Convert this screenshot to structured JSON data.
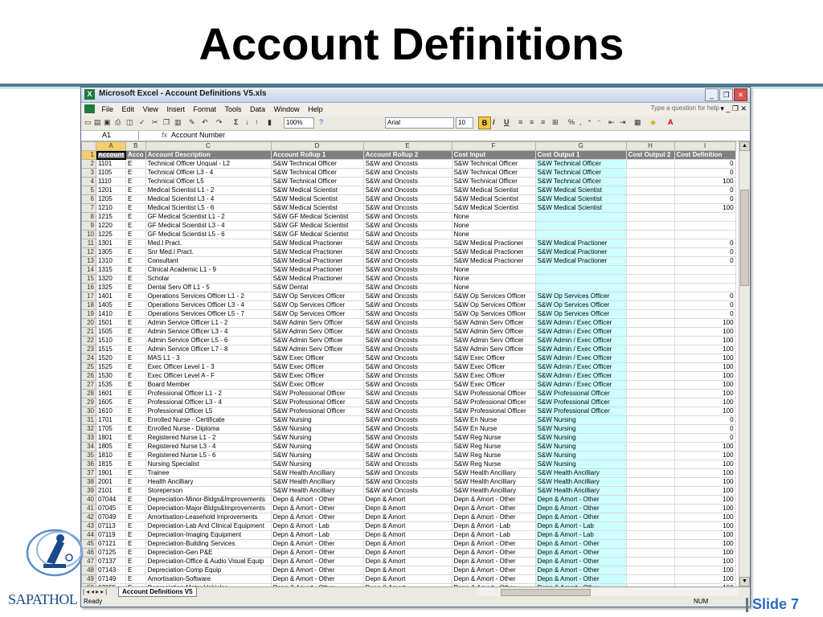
{
  "slide": {
    "title": "Account Definitions",
    "slide_number": "Slide 7",
    "logo_text": "SAPATHOL"
  },
  "window": {
    "title": "Microsoft Excel - Account Definitions V5.xls",
    "menus": [
      "File",
      "Edit",
      "View",
      "Insert",
      "Format",
      "Tools",
      "Data",
      "Window",
      "Help"
    ],
    "help_placeholder": "Type a question for help",
    "zoom": "100%",
    "font_name": "Arial",
    "font_size": "10",
    "name_box": "A1",
    "formula": "Account Number",
    "sheet_tab": "Account Definitions V5",
    "status": "Ready",
    "num_lock": "NUM"
  },
  "sheet": {
    "columns": [
      "A",
      "B",
      "C",
      "D",
      "E",
      "F",
      "G",
      "H",
      "I"
    ],
    "header_row": [
      "Account",
      "Acco",
      "Account Description",
      "Account Rollup 1",
      "Account Rollup 2",
      "Cost Input",
      "Cost Output 1",
      "Cost Output 2",
      "Cost Definition"
    ],
    "rows": [
      [
        "2",
        "1101",
        "E",
        "Technical Officer Unqual - L2",
        "S&W Technical Officer",
        "S&W and Oncosts",
        "S&W Technical Officer",
        "S&W Technical Officer",
        "",
        "0"
      ],
      [
        "3",
        "1105",
        "E",
        "Technical Officer L3 - 4",
        "S&W Technical Officer",
        "S&W and Oncosts",
        "S&W Technical Officer",
        "S&W Technical Officer",
        "",
        "0"
      ],
      [
        "4",
        "1110",
        "E",
        "Technical Officer L5",
        "S&W Technical Officer",
        "S&W and Oncosts",
        "S&W Technical Officer",
        "S&W Technical Officer",
        "",
        "100"
      ],
      [
        "5",
        "1201",
        "E",
        "Medical Scientist L1 - 2",
        "S&W Medical Scientist",
        "S&W and Oncosts",
        "S&W Medical Scientist",
        "S&W Medical Scientist",
        "",
        "0"
      ],
      [
        "6",
        "1205",
        "E",
        "Medical Scientist L3 - 4",
        "S&W Medical Scientist",
        "S&W and Oncosts",
        "S&W Medical Scientist",
        "S&W Medical Scientist",
        "",
        "0"
      ],
      [
        "7",
        "1210",
        "E",
        "Medical Scientist L5 - 6",
        "S&W Medical Scientist",
        "S&W and Oncosts",
        "S&W Medical Scientist",
        "S&W Medical Scientist",
        "",
        "100"
      ],
      [
        "8",
        "1215",
        "E",
        "GF Medical Scientist L1 - 2",
        "S&W GF Medical Scientist",
        "S&W and Oncosts",
        "None",
        "",
        "",
        ""
      ],
      [
        "9",
        "1220",
        "E",
        "GF Medical Scientist L3 - 4",
        "S&W GF Medical Scientist",
        "S&W and Oncosts",
        "None",
        "",
        "",
        ""
      ],
      [
        "10",
        "1225",
        "E",
        "GF Medical Scientist L5 - 6",
        "S&W GF Medical Scientist",
        "S&W and Oncosts",
        "None",
        "",
        "",
        ""
      ],
      [
        "11",
        "1301",
        "E",
        "Med.l Pract.",
        "S&W Medical Practioner",
        "S&W and Oncosts",
        "S&W Medical Practioner",
        "S&W Medical Practioner",
        "",
        "0"
      ],
      [
        "12",
        "1305",
        "E",
        "Snr Med.l Pract.",
        "S&W Medical Practioner",
        "S&W and Oncosts",
        "S&W Medical Practioner",
        "S&W Medical Practioner",
        "",
        "0"
      ],
      [
        "13",
        "1310",
        "E",
        "Consultant",
        "S&W Medical Practioner",
        "S&W and Oncosts",
        "S&W Medical Practioner",
        "S&W Medical Practioner",
        "",
        "0"
      ],
      [
        "14",
        "1315",
        "E",
        "Clinical Academic L1 - 9",
        "S&W Medical Practioner",
        "S&W and Oncosts",
        "None",
        "",
        "",
        ""
      ],
      [
        "15",
        "1320",
        "E",
        "Scholar",
        "S&W Medical Practioner",
        "S&W and Oncosts",
        "None",
        "",
        "",
        ""
      ],
      [
        "16",
        "1325",
        "E",
        "Dental Serv Off L1 - 5",
        "S&W Dental",
        "S&W and Oncosts",
        "None",
        "",
        "",
        ""
      ],
      [
        "17",
        "1401",
        "E",
        "Operations Services Officer L1 - 2",
        "S&W Op Services Officer",
        "S&W and Oncosts",
        "S&W Op Services Officer",
        "S&W Op Services Officer",
        "",
        "0"
      ],
      [
        "18",
        "1405",
        "E",
        "Operations Services Officer L3 - 4",
        "S&W Op Services Officer",
        "S&W and Oncosts",
        "S&W Op Services Officer",
        "S&W Op Services Officer",
        "",
        "0"
      ],
      [
        "19",
        "1410",
        "E",
        "Operations Services Officer L5 - 7",
        "S&W Op Services Officer",
        "S&W and Oncosts",
        "S&W Op Services Officer",
        "S&W Op Services Officer",
        "",
        "0"
      ],
      [
        "20",
        "1501",
        "E",
        "Admin Service Officer L1 - 2",
        "S&W Admin Serv Officer",
        "S&W and Oncosts",
        "S&W Admin Serv Officer",
        "S&W Admin / Exec Officer",
        "",
        "100"
      ],
      [
        "21",
        "1505",
        "E",
        "Admin Service Officer L3 - 4",
        "S&W Admin Serv Officer",
        "S&W and Oncosts",
        "S&W Admin Serv Officer",
        "S&W Admin / Exec Officer",
        "",
        "100"
      ],
      [
        "22",
        "1510",
        "E",
        "Admin Service Officer L5 - 6",
        "S&W Admin Serv Officer",
        "S&W and Oncosts",
        "S&W Admin Serv Officer",
        "S&W Admin / Exec Officer",
        "",
        "100"
      ],
      [
        "23",
        "1515",
        "E",
        "Admin Service Officer L7 - 8",
        "S&W Admin Serv Officer",
        "S&W and Oncosts",
        "S&W Admin Serv Officer",
        "S&W Admin / Exec Officer",
        "",
        "100"
      ],
      [
        "24",
        "1520",
        "E",
        "MAS L1 - 3",
        "S&W Exec Officer",
        "S&W and Oncosts",
        "S&W Exec Officer",
        "S&W Admin / Exec Officer",
        "",
        "100"
      ],
      [
        "25",
        "1525",
        "E",
        "Exec Officer Level 1 - 3",
        "S&W Exec Officer",
        "S&W and Oncosts",
        "S&W Exec Officer",
        "S&W Admin / Exec Officer",
        "",
        "100"
      ],
      [
        "26",
        "1530",
        "E",
        "Exec Officer Level A - F",
        "S&W Exec Officer",
        "S&W and Oncosts",
        "S&W Exec Officer",
        "S&W Admin / Exec Officer",
        "",
        "100"
      ],
      [
        "27",
        "1535",
        "E",
        "Board Member",
        "S&W Exec Officer",
        "S&W and Oncosts",
        "S&W Exec Officer",
        "S&W Admin / Exec Officer",
        "",
        "100"
      ],
      [
        "28",
        "1601",
        "E",
        "Professional Officer L1 - 2",
        "S&W Professional Officer",
        "S&W and Oncosts",
        "S&W Professional Officer",
        "S&W Professional Officer",
        "",
        "100"
      ],
      [
        "29",
        "1605",
        "E",
        "Professional Officer L3 - 4",
        "S&W Professional Officer",
        "S&W and Oncosts",
        "S&W Professional Officer",
        "S&W Professional Officer",
        "",
        "100"
      ],
      [
        "30",
        "1610",
        "E",
        "Professional Officer L5",
        "S&W Professional Officer",
        "S&W and Oncosts",
        "S&W Professional Officer",
        "S&W Professional Officer",
        "",
        "100"
      ],
      [
        "31",
        "1701",
        "E",
        "Enrolled Nurse - Certificate",
        "S&W Nursing",
        "S&W and Oncosts",
        "S&W En Nurse",
        "S&W Nursing",
        "",
        "0"
      ],
      [
        "32",
        "1705",
        "E",
        "Enrolled Nurse - Diploma",
        "S&W Nursing",
        "S&W and Oncosts",
        "S&W En Nurse",
        "S&W Nursing",
        "",
        "0"
      ],
      [
        "33",
        "1801",
        "E",
        "Registered Nurse L1 - 2",
        "S&W Nursing",
        "S&W and Oncosts",
        "S&W Reg Nurse",
        "S&W Nursing",
        "",
        "0"
      ],
      [
        "34",
        "1805",
        "E",
        "Registered Nurse L3 - 4",
        "S&W Nursing",
        "S&W and Oncosts",
        "S&W Reg Nurse",
        "S&W Nursing",
        "",
        "100"
      ],
      [
        "35",
        "1810",
        "E",
        "Registered Nurse L5 - 6",
        "S&W Nursing",
        "S&W and Oncosts",
        "S&W Reg Nurse",
        "S&W Nursing",
        "",
        "100"
      ],
      [
        "36",
        "1815",
        "E",
        "Nursing Specialist",
        "S&W Nursing",
        "S&W and Oncosts",
        "S&W Reg Nurse",
        "S&W Nursing",
        "",
        "100"
      ],
      [
        "37",
        "1901",
        "E",
        "Trainee",
        "S&W Health Ancilliary",
        "S&W and Oncosts",
        "S&W Health Ancilliary",
        "S&W Health Ancilliary",
        "",
        "100"
      ],
      [
        "38",
        "2001",
        "E",
        "Health Ancilliary",
        "S&W Health Ancilliary",
        "S&W and Oncosts",
        "S&W Health Ancilliary",
        "S&W Health Ancilliary",
        "",
        "100"
      ],
      [
        "39",
        "2101",
        "E",
        "Storeperson",
        "S&W Health Ancilliary",
        "S&W and Oncosts",
        "S&W Health Ancilliary",
        "S&W Health Ancilliary",
        "",
        "100"
      ],
      [
        "40",
        "07044",
        "E",
        "Depreciation-Minor-Bldgs&Improvements",
        "Depn & Amort - Other",
        "Depn & Amort",
        "Depn & Amort - Other",
        "Depn & Amort - Other",
        "",
        "100"
      ],
      [
        "41",
        "07045",
        "E",
        "Depreciation-Major-Bldgs&Improvements",
        "Depn & Amort - Other",
        "Depn & Amort",
        "Depn & Amort - Other",
        "Depn & Amort - Other",
        "",
        "100"
      ],
      [
        "42",
        "07049",
        "E",
        "Amortisation-Leasehold Improvements",
        "Depn & Amort - Other",
        "Depn & Amort",
        "Depn & Amort - Other",
        "Depn & Amort - Other",
        "",
        "100"
      ],
      [
        "43",
        "07113",
        "E",
        "Depreciation-Lab And Clinical Equipment",
        "Depn & Amort - Lab",
        "Depn & Amort",
        "Depn & Amort - Lab",
        "Depn & Amort - Lab",
        "",
        "100"
      ],
      [
        "44",
        "07119",
        "E",
        "Depreciation-Imaging Equipment",
        "Depn & Amort - Lab",
        "Depn & Amort",
        "Depn & Amort - Lab",
        "Depn & Amort - Lab",
        "",
        "100"
      ],
      [
        "45",
        "07121",
        "E",
        "Depreciation-Building Services",
        "Depn & Amort - Other",
        "Depn & Amort",
        "Depn & Amort - Other",
        "Depn & Amort - Other",
        "",
        "100"
      ],
      [
        "46",
        "07125",
        "E",
        "Depreciation-Gen P&E",
        "Depn & Amort - Other",
        "Depn & Amort",
        "Depn & Amort - Other",
        "Depn & Amort - Other",
        "",
        "100"
      ],
      [
        "47",
        "07137",
        "E",
        "Depreciation-Office & Audio Visual Equip",
        "Depn & Amort - Other",
        "Depn & Amort",
        "Depn & Amort - Other",
        "Depn & Amort - Other",
        "",
        "100"
      ],
      [
        "48",
        "07143",
        "E",
        "Depreciation-Comp Equip",
        "Depn & Amort - Other",
        "Depn & Amort",
        "Depn & Amort - Other",
        "Depn & Amort - Other",
        "",
        "100"
      ],
      [
        "49",
        "07149",
        "E",
        "Amortisation-Software",
        "Depn & Amort - Other",
        "Depn & Amort",
        "Depn & Amort - Other",
        "Depn & Amort - Other",
        "",
        "100"
      ],
      [
        "50",
        "07155",
        "E",
        "Depreciation-Motor Vehicles",
        "Depn & Amort - Other",
        "Depn & Amort",
        "Depn & Amort - Other",
        "Depn & Amort - Other",
        "",
        "100"
      ]
    ]
  },
  "colors": {
    "header_fill": "#808080",
    "cost_output_fill": "#ccffff",
    "title_rule": "#4a7f8c",
    "slide_number": "#2d6bbf"
  }
}
